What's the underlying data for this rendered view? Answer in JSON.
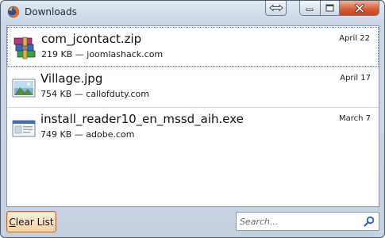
{
  "window": {
    "title": "Downloads",
    "icon": "firefox-icon",
    "controls": {
      "resize": "resize-icon",
      "minimize": "minimize-icon",
      "maximize": "maximize-icon",
      "close": "close-icon"
    },
    "close_color": "#d85a34"
  },
  "downloads": [
    {
      "name": "com_jcontact.zip",
      "size": "219 KB",
      "source": "joomlashack.com",
      "date": "April 22",
      "icon": "zip-archive-icon",
      "selected": true
    },
    {
      "name": "Village.jpg",
      "size": "754 KB",
      "source": "callofduty.com",
      "date": "April 17",
      "icon": "image-file-icon",
      "selected": false
    },
    {
      "name": "install_reader10_en_mssd_aih.exe",
      "size": "749 KB",
      "source": "adobe.com",
      "date": "March 7",
      "icon": "exe-file-icon",
      "selected": false
    }
  ],
  "footer": {
    "clear_label_first": "C",
    "clear_label_rest": "lear List",
    "search_placeholder": "Search..."
  },
  "separator": " — "
}
